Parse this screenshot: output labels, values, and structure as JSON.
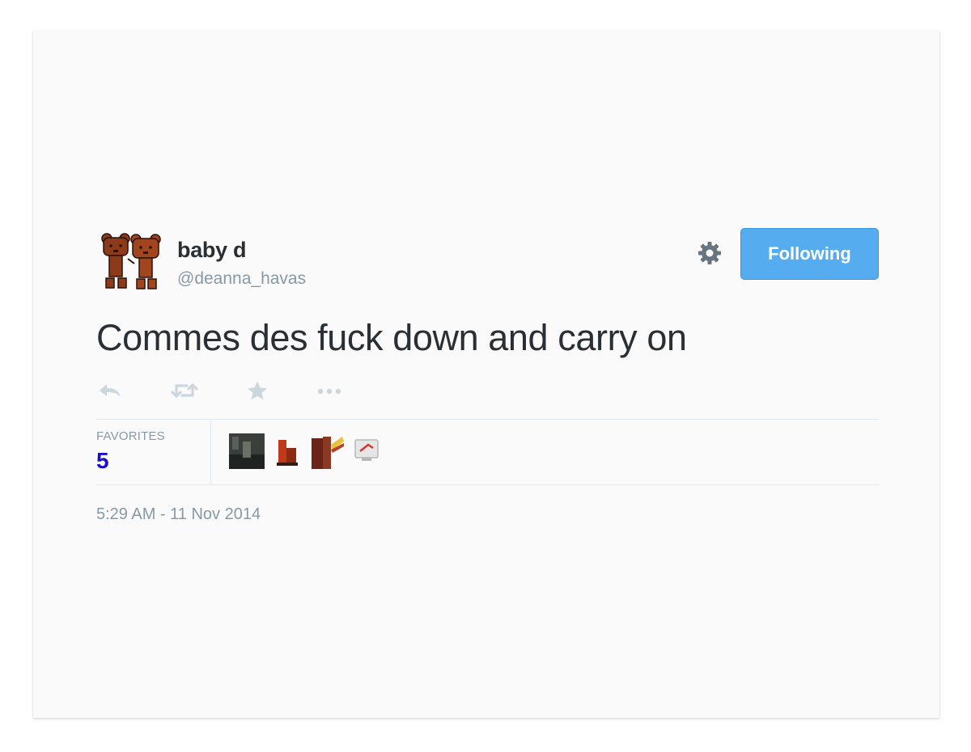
{
  "tweet": {
    "user": {
      "display_name": "baby d",
      "handle": "@deanna_havas"
    },
    "follow_button_label": "Following",
    "text": "Commes des fuck down and carry on",
    "actions": [
      "reply-icon",
      "retweet-icon",
      "favorite-star-icon",
      "more-icon"
    ],
    "favorites": {
      "label": "FAVORITES",
      "count": "5"
    },
    "timestamp": "5:29 AM - 11 Nov 2014"
  },
  "colors": {
    "follow_button": "#55acee",
    "favorite_count": "#1a0dcc",
    "muted_text": "#8899a6",
    "primary_text": "#292f33"
  }
}
